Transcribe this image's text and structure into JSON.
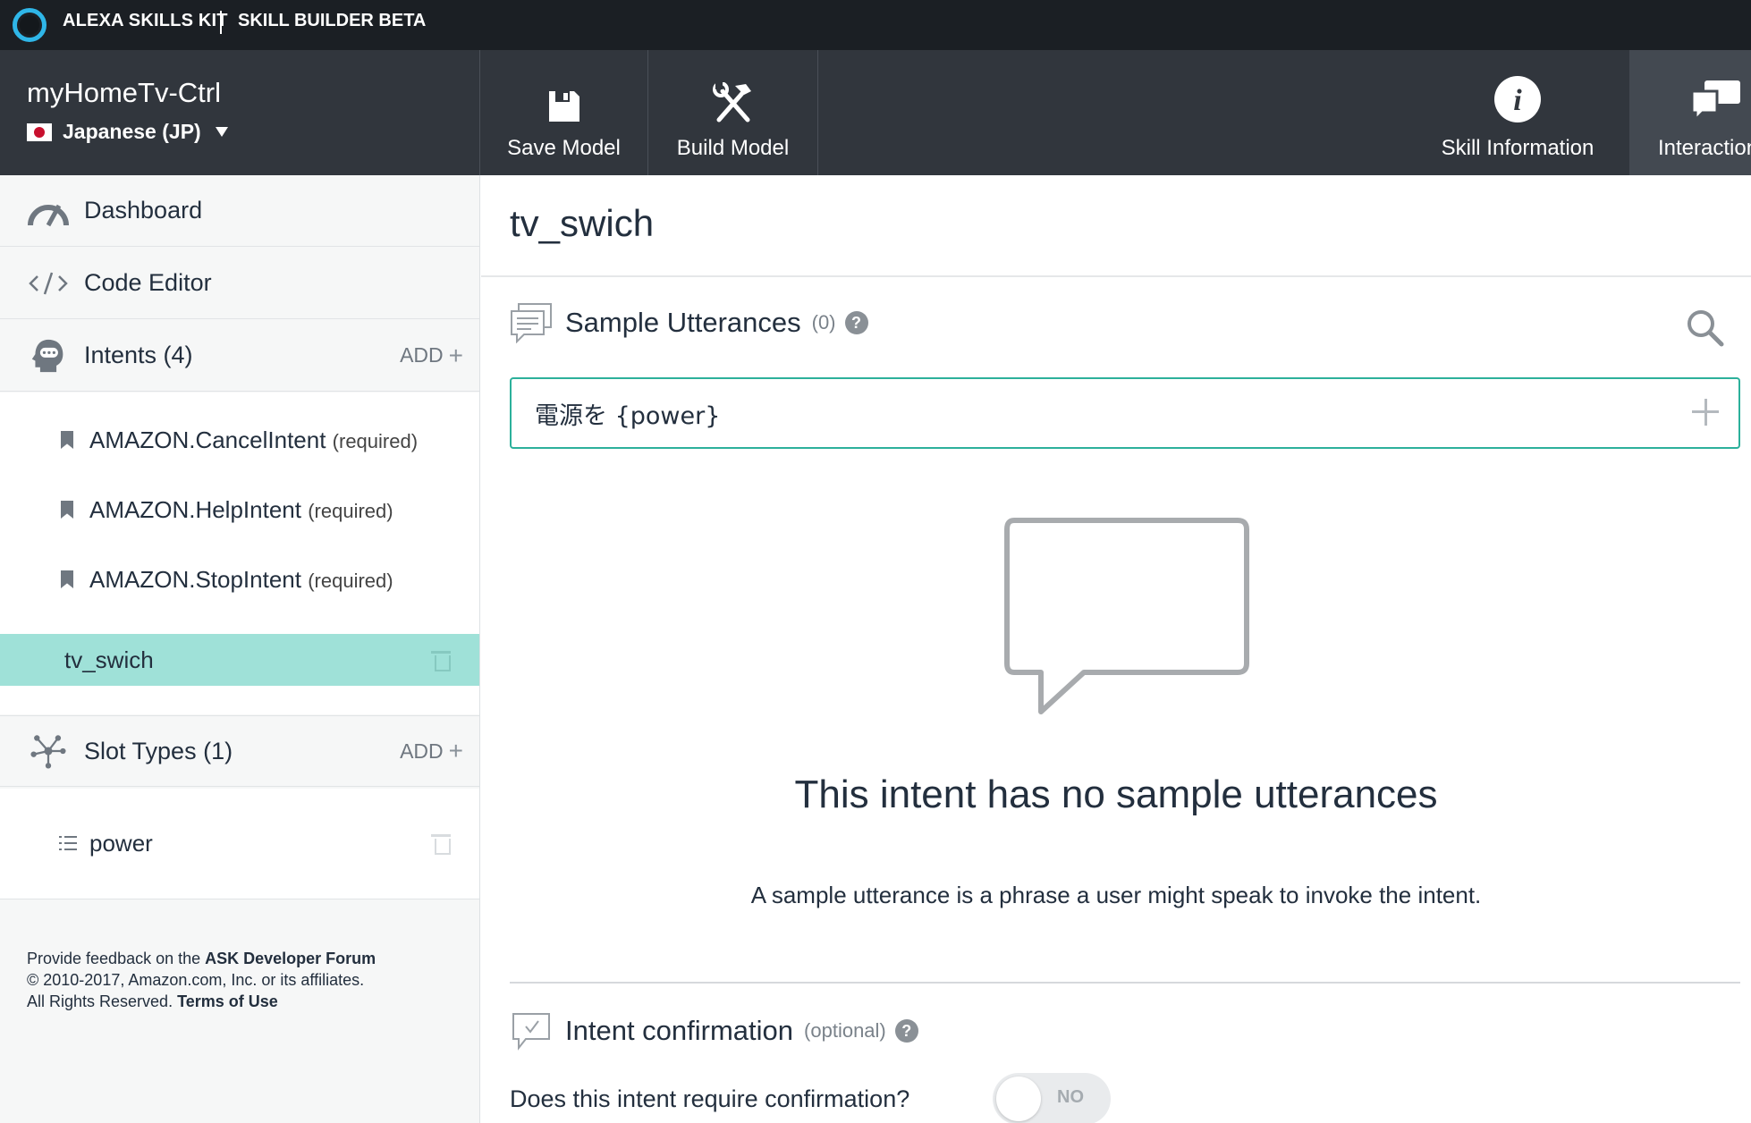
{
  "topbar": {
    "brand": "ALEXA SKILLS KIT",
    "beta": "SKILL BUILDER BETA"
  },
  "skill": {
    "name": "myHomeTv-Ctrl",
    "locale": "Japanese (JP)"
  },
  "toolbar": {
    "save_label": "Save Model",
    "build_label": "Build Model",
    "info_label": "Skill Information",
    "interaction_label": "Interaction"
  },
  "sidebar": {
    "dashboard": "Dashboard",
    "code_editor": "Code Editor",
    "intents_label": "Intents (4)",
    "intents_add": "ADD",
    "intents": [
      {
        "name": "AMAZON.CancelIntent",
        "tag": "(required)"
      },
      {
        "name": "AMAZON.HelpIntent",
        "tag": "(required)"
      },
      {
        "name": "AMAZON.StopIntent",
        "tag": "(required)"
      },
      {
        "name": "tv_swich",
        "tag": ""
      }
    ],
    "slots_label": "Slot Types (1)",
    "slots_add": "ADD",
    "slots": [
      {
        "name": "power"
      }
    ]
  },
  "footer": {
    "line1_prefix": "Provide feedback on the ",
    "forum_link": "ASK Developer Forum",
    "line2": "© 2010-2017, Amazon.com, Inc. or its affiliates.",
    "line3_prefix": "All Rights Reserved. ",
    "terms_link": "Terms of Use"
  },
  "main": {
    "intent_title": "tv_swich",
    "utterances": {
      "title": "Sample Utterances",
      "count": "(0)",
      "help": "?",
      "input_value": "電源を {power}"
    },
    "empty": {
      "title": "This intent has no sample utterances",
      "description": "A sample utterance is a phrase a user might speak to invoke the intent."
    },
    "confirmation": {
      "title": "Intent confirmation",
      "optional": "(optional)",
      "help": "?",
      "question": "Does this intent require confirmation?",
      "toggle_label": "NO"
    }
  },
  "colors": {
    "topbar_bg": "#1b1f24",
    "header_bg": "#31363d",
    "active_item": "#9fe1d8",
    "input_border": "#2cb09b",
    "alexa_ring": "#2fb6e8"
  }
}
